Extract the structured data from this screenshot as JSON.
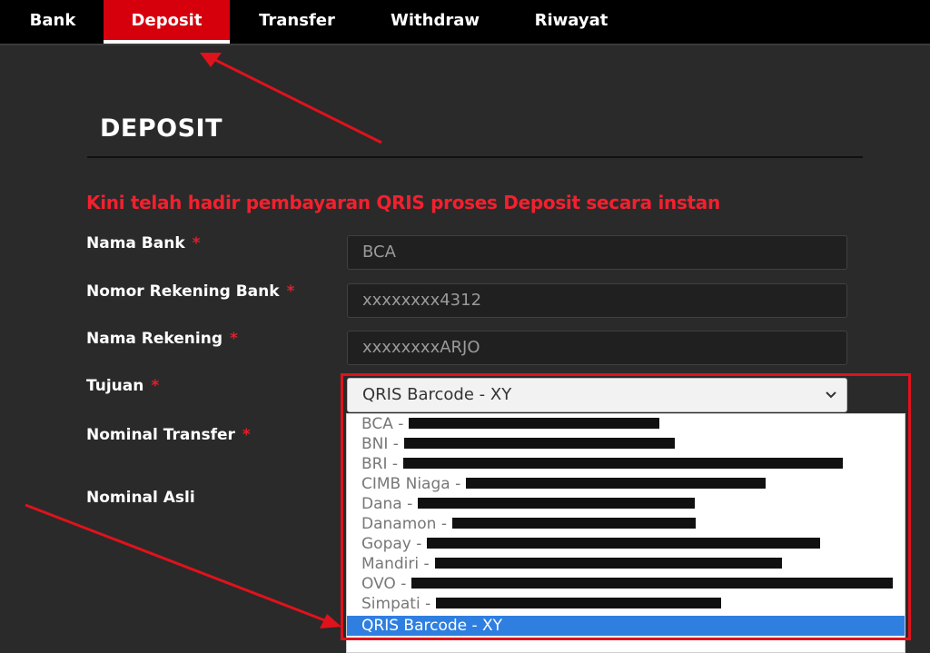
{
  "nav": {
    "tabs": [
      {
        "label": "Bank",
        "active": false
      },
      {
        "label": "Deposit",
        "active": true
      },
      {
        "label": "Transfer",
        "active": false
      },
      {
        "label": "Withdraw",
        "active": false
      },
      {
        "label": "Riwayat",
        "active": false
      }
    ]
  },
  "page": {
    "title": "DEPOSIT",
    "promo": "Kini telah hadir pembayaran QRIS proses Deposit secara instan"
  },
  "form": {
    "required_mark": "*",
    "nama_bank": {
      "label": "Nama Bank",
      "value": "BCA"
    },
    "nomor_rekening": {
      "label": "Nomor Rekening Bank",
      "value": "xxxxxxxx4312"
    },
    "nama_rekening": {
      "label": "Nama Rekening",
      "value": "xxxxxxxxARJO"
    },
    "tujuan": {
      "label": "Tujuan",
      "value": "QRIS Barcode - XY"
    },
    "nominal_transfer": {
      "label": "Nominal Transfer"
    },
    "nominal_asli": {
      "label": "Nominal Asli"
    }
  },
  "dropdown": {
    "options": [
      {
        "label": "BCA -",
        "redacted": true
      },
      {
        "label": "BNI -",
        "redacted": true
      },
      {
        "label": "BRI -",
        "redacted": true
      },
      {
        "label": "CIMB Niaga -",
        "redacted": true
      },
      {
        "label": "Dana -",
        "redacted": true
      },
      {
        "label": "Danamon -",
        "redacted": true
      },
      {
        "label": "Gopay -",
        "redacted": true
      },
      {
        "label": "Mandiri -",
        "redacted": true
      },
      {
        "label": "OVO -",
        "redacted": true
      },
      {
        "label": "Simpati -",
        "redacted": true
      },
      {
        "label": "QRIS Barcode - XY",
        "redacted": false,
        "selected": true
      }
    ]
  },
  "colors": {
    "accent": "#d6000c",
    "annotation": "#e0121c",
    "selected_option": "#2f7fe0"
  }
}
